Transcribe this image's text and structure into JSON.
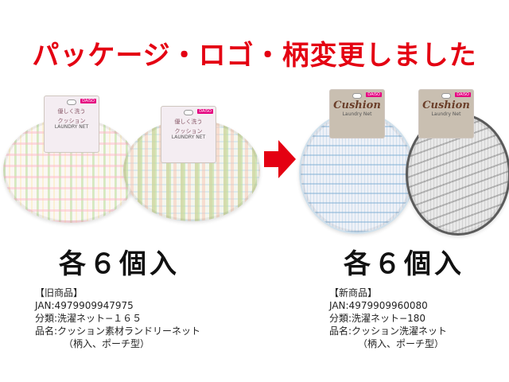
{
  "headline": "パッケージ・ロゴ・柄変更しました",
  "colors": {
    "headline": "#e40012",
    "arrow": "#e40012"
  },
  "old_product": {
    "card_brand": "DAISO",
    "card_title_line1": "優しく洗う",
    "card_title_line2": "クッション",
    "card_subtitle": "LAUNDRY NET",
    "count_text": "各６個入",
    "info": {
      "label": "【旧商品】",
      "jan": "JAN:4979909947975",
      "category": "分類:洗濯ネット−１６５",
      "name": "品名:クッション素材ランドリーネット",
      "name_sub": "（柄入、ポーチ型）"
    }
  },
  "new_product": {
    "card_brand": "DAISO",
    "card_title": "Cushion",
    "card_subtitle": "Laundry Net",
    "count_text": "各６個入",
    "info": {
      "label": "【新商品】",
      "jan": "JAN:4979909960080",
      "category": "分類:洗濯ネット−180",
      "name": "品名:クッション洗濯ネット",
      "name_sub": "（柄入、ポーチ型）"
    }
  },
  "arrow_icon": "right-arrow-icon"
}
